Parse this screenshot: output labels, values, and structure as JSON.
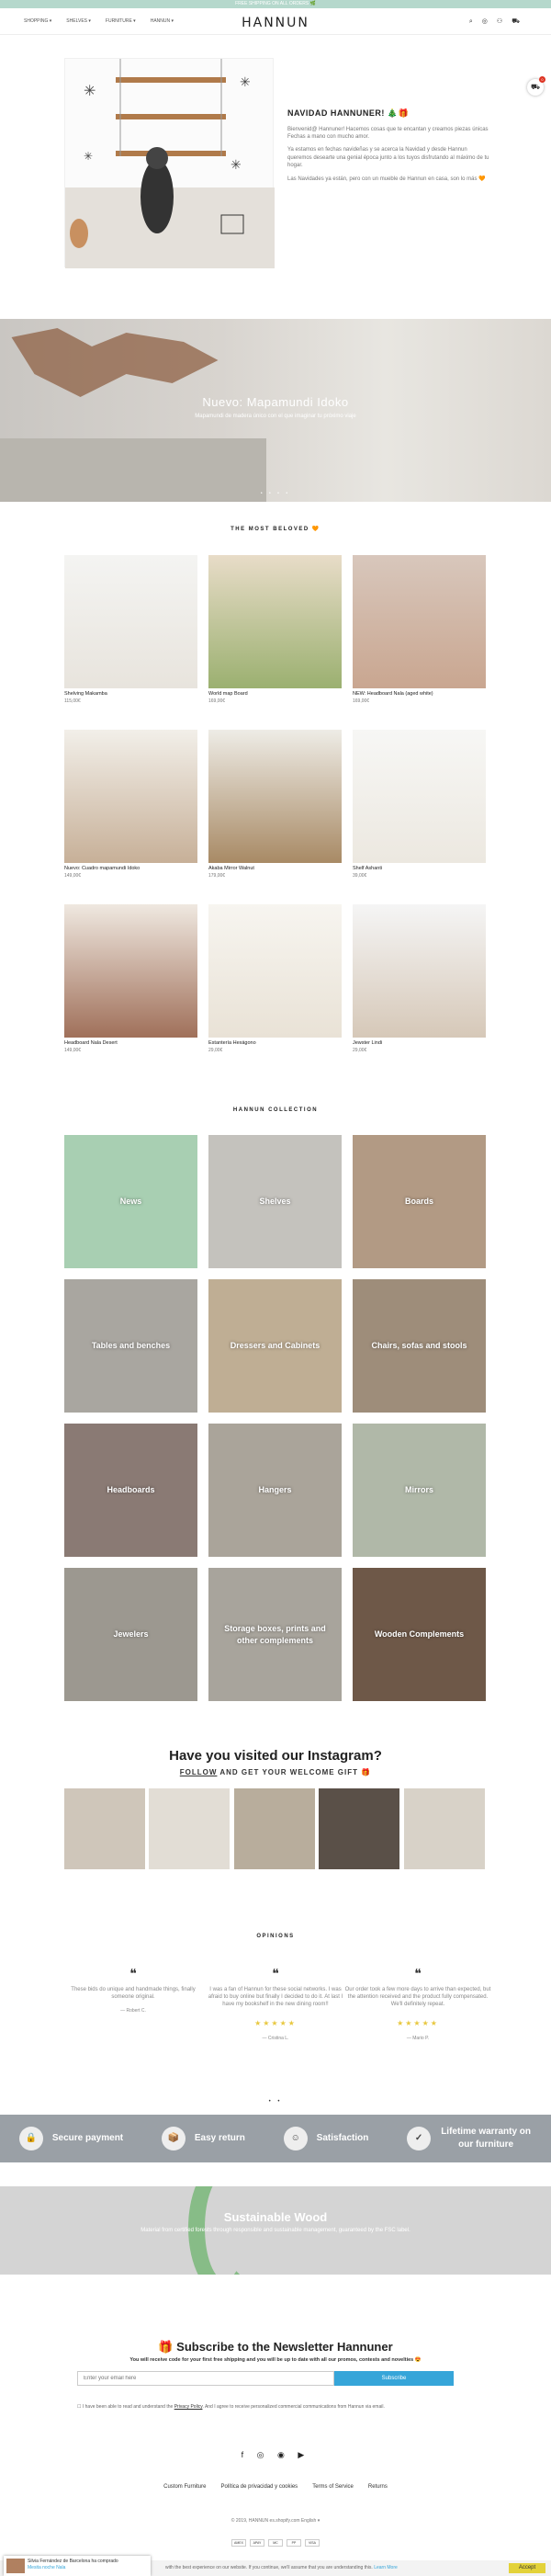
{
  "topbar": "FREE SHIPPING ON ALL ORDERS 🌿",
  "nav": [
    "SHOPPING ▾",
    "SHELVES ▾",
    "FURNITURE ▾",
    "HANNUN ▾"
  ],
  "logo": "HANNUN",
  "cart_count": "0",
  "xmas": {
    "title": "NAVIDAD HANNUNER! 🎄🎁",
    "p1": "Bienvenid@ Hannuner! Hacemos cosas que te encantan y creamos piezas únicas Fechas a mano con mucho amor.",
    "p2": "Ya estamos en fechas navideñas y se acerca la Navidad y desde Hannun queremos desearte una genial época junto a los tuyos disfrutando al máximo de tu hogar.",
    "p3": "Las Navidades ya están, pero con un mueble de Hannun en casa, son lo más 🧡"
  },
  "hero": {
    "title": "Nuevo: Mapamundi Idoko",
    "sub": "Mapamundi de madera único con el que imaginar tu próximo viaje",
    "dots": "• • • •"
  },
  "beloved": {
    "title": "THE MOST BELOVED 🧡",
    "items": [
      {
        "name": "Shelving Makamba",
        "price": "115,00€"
      },
      {
        "name": "World map Board",
        "price": "169,00€"
      },
      {
        "name": "NEW: Headboard Nala (aged white)",
        "price": "169,00€"
      },
      {
        "name": "Nuevo: Cuadro mapamundi Idoko",
        "price": "149,00€"
      },
      {
        "name": "Akaba Mirror Walnut",
        "price": "179,00€"
      },
      {
        "name": "Shelf Ashanti",
        "price": "39,00€"
      },
      {
        "name": "Headboard Nala Desert",
        "price": "149,00€"
      },
      {
        "name": "Estantería Hexágono",
        "price": "29,00€"
      },
      {
        "name": "Jewster Lindi",
        "price": "29,00€"
      }
    ]
  },
  "collection": {
    "title": "HANNUN COLLECTION",
    "items": [
      "News",
      "Shelves",
      "Boards",
      "Tables and benches",
      "Dressers and Cabinets",
      "Chairs, sofas and stools",
      "Headboards",
      "Hangers",
      "Mirrors",
      "Jewelers",
      "Storage boxes, prints and other complements",
      "Wooden Complements"
    ]
  },
  "instagram": {
    "title": "Have you visited our Instagram?",
    "follow": "FOLLOW",
    "rest": " AND GET YOUR WELCOME GIFT 🎁"
  },
  "opinions": {
    "title": "OPINIONS",
    "items": [
      {
        "text": "These bids do unique and handmade things, finally someone original.",
        "who": "— Robert C."
      },
      {
        "text": "I was a fan of Hannun for these social networks. I was afraid to buy online but finally I decided to do it. At last I have my bookshelf in the new dining room!!",
        "who": "— Cristina L."
      },
      {
        "text": "Our order took a few more days to arrive than expected, but the attention received and the product fully compensated. We'll definitely repeat.",
        "who": "— Mario P."
      }
    ],
    "stars": "★★★★★",
    "dots": "• •"
  },
  "features": [
    "Secure payment",
    "Easy return",
    "Satisfaction",
    "Lifetime warranty on our furniture"
  ],
  "sustainable": {
    "title": "Sustainable Wood",
    "text": "Material from certified forests through responsible and sustainable management, guaranteed by the FSC label."
  },
  "newsletter": {
    "title": "🎁 Subscribe to the Newsletter Hannuner",
    "sub": "You will receive code for your first free shipping and you will be up to date with all our promos, contests and novelties 😍",
    "placeholder": "Enter your email here",
    "button": "Subscribe",
    "check_a": "I have been able to read and understand the ",
    "privacy": "Privacy Policy",
    "check_b": ". And I agree to receive personalized commercial communications from Hannun via email."
  },
  "social": "f ◎ ◉ ▶",
  "footer_links": [
    "Custom Furniture",
    "Política de privacidad y cookies",
    "Terms of Service",
    "Returns"
  ],
  "copyright": "© 2019, HANNUN    es.shopify.com    English ▾",
  "payments": [
    "AMEX",
    "APAY",
    "MC",
    "PP",
    "VISA"
  ],
  "popup": {
    "line1": "Silvia Fernández de Barcelona ha comprado",
    "line2": "Mesita noche Nala"
  },
  "cookie": {
    "text": "with the best experience on our website. If you continue, we'll assume that you are understanding this. ",
    "link": "Learn More",
    "accept": "Accept"
  }
}
